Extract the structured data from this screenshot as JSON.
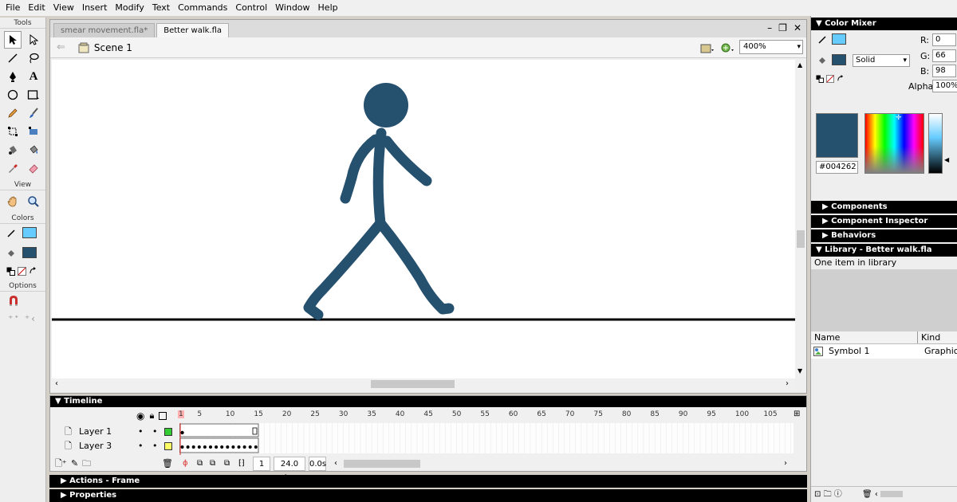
{
  "menu": [
    "File",
    "Edit",
    "View",
    "Insert",
    "Modify",
    "Text",
    "Commands",
    "Control",
    "Window",
    "Help"
  ],
  "tools": {
    "section_tools": "Tools",
    "section_view": "View",
    "section_colors": "Colors",
    "section_options": "Options"
  },
  "document": {
    "tabs": [
      "smear movement.fla*",
      "Better walk.fla"
    ],
    "scene": "Scene 1",
    "zoom": "400%"
  },
  "timeline": {
    "title": "Timeline",
    "ruler": [
      "1",
      "5",
      "10",
      "15",
      "20",
      "25",
      "30",
      "35",
      "40",
      "45",
      "50",
      "55",
      "60",
      "65",
      "70",
      "75",
      "80",
      "85",
      "90",
      "95",
      "100",
      "105"
    ],
    "layers": [
      {
        "name": "Layer 1",
        "color": "#33cc33"
      },
      {
        "name": "Layer 3",
        "color": "#ffff66"
      }
    ],
    "status": {
      "frame": "1",
      "fps": "24.0 fps",
      "time": "0.0s"
    }
  },
  "bottom_panels": [
    "Actions - Frame",
    "Properties"
  ],
  "color_mixer": {
    "title": "Color Mixer",
    "fill_type": "Solid",
    "r_label": "R:",
    "r": "0",
    "g_label": "G:",
    "g": "66",
    "b_label": "B:",
    "b": "98",
    "alpha_label": "Alpha:",
    "alpha": "100%",
    "hex": "#004262",
    "stroke_color": "#66ccff",
    "fill_color": "#004262"
  },
  "collapsed_panels": [
    "Components",
    "Component Inspector",
    "Behaviors"
  ],
  "library": {
    "title": "Library - Better walk.fla",
    "count_text": "One item in library",
    "col_name": "Name",
    "col_kind": "Kind",
    "items": [
      {
        "name": "Symbol 1",
        "kind": "Graphic"
      }
    ]
  },
  "stick_figure_color": "#25506e"
}
